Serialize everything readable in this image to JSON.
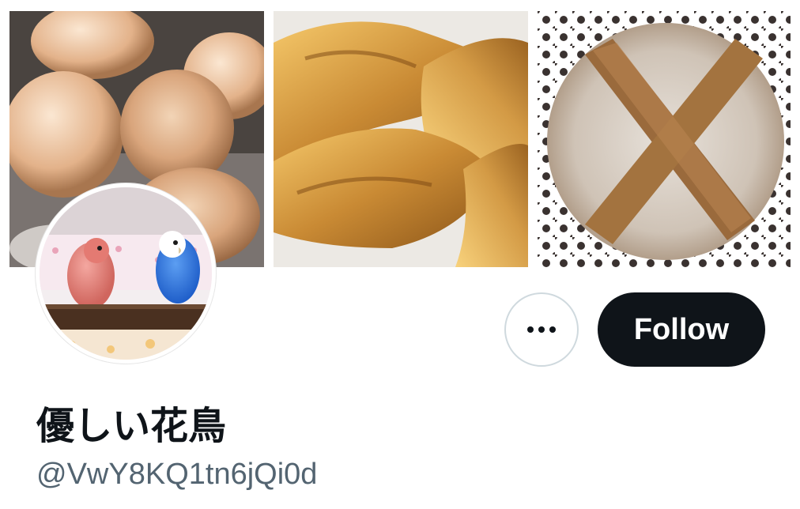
{
  "profile": {
    "display_name": "優しい花鳥",
    "handle": "@VwY8KQ1tn6jQi0d"
  },
  "actions": {
    "follow_label": "Follow",
    "more_icon": "more-horizontal-icon"
  },
  "colors": {
    "follow_background": "#0f1419",
    "follow_text": "#ffffff",
    "text_primary": "#0f1419",
    "text_secondary": "#536471",
    "button_border": "#cfd9de"
  }
}
